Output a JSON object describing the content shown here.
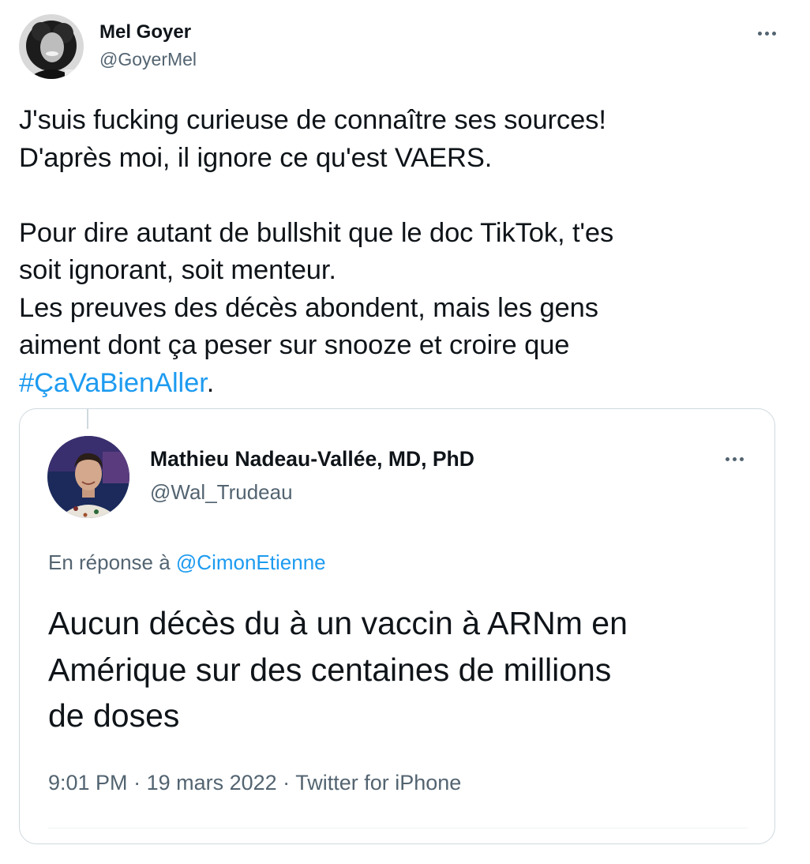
{
  "outer_tweet": {
    "author_name": "Mel Goyer",
    "author_handle": "@GoyerMel",
    "more_label": "More",
    "body_lines": [
      "J'suis fucking curieuse de connaître ses sources!",
      "D'après moi, il ignore ce qu'est VAERS.",
      "",
      "Pour dire autant de bullshit que le doc TikTok, t'es",
      "soit ignorant, soit menteur.",
      "Les preuves des décès abondent, mais les gens",
      "aiment dont ça peser sur snooze et croire que"
    ],
    "hashtag": "#ÇaVaBienAller",
    "hashtag_suffix": "."
  },
  "quoted_tweet": {
    "author_name": "Mathieu Nadeau-Vallée, MD, PhD",
    "author_handle": "@Wal_Trudeau",
    "reply_prefix": "En réponse à",
    "reply_mention": "@CimonEtienne",
    "body_lines": [
      "Aucun décès du à un vaccin à ARNm en",
      "Amérique sur des centaines de millions",
      "de doses"
    ],
    "time": "9:01 PM",
    "separator": " · ",
    "date": "19 mars 2022",
    "source": "Twitter for iPhone"
  },
  "colors": {
    "text": "#0f1419",
    "secondary": "#536471",
    "link": "#1d9bf0",
    "border": "#cfd9de"
  },
  "icons": {
    "outer_more": "more-horizontal-icon",
    "quote_more": "more-horizontal-icon"
  }
}
